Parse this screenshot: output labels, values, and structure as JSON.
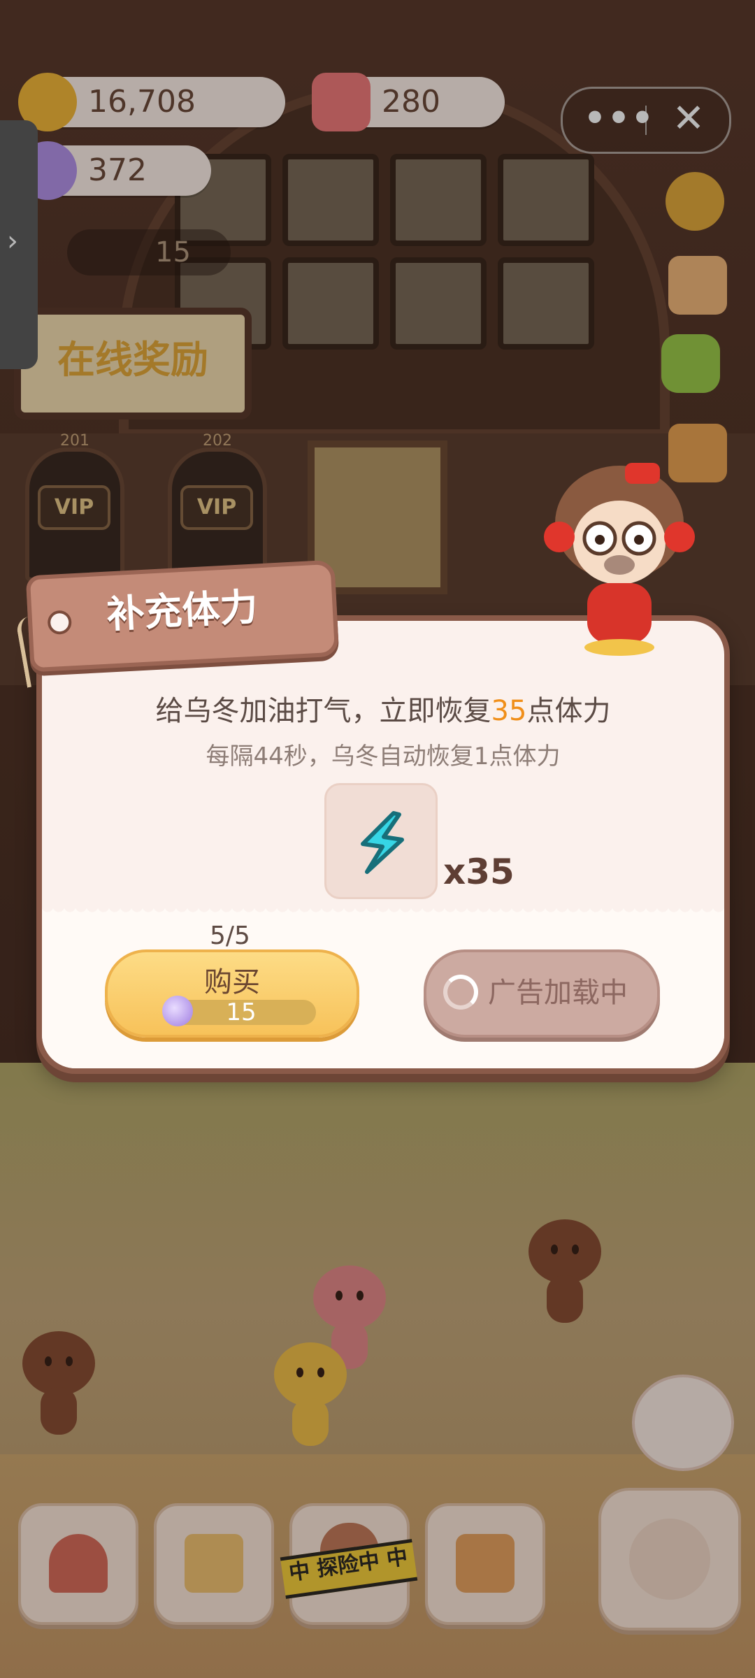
{
  "hud": {
    "coins": "16,708",
    "candles": "280",
    "candy": "372",
    "small_counter": "15",
    "capsule_more": "•••",
    "capsule_close": "✕",
    "side_tab_arrow": "›"
  },
  "scene": {
    "sign_text": "在线奖励",
    "door_left_num": "201",
    "door_right_num": "202",
    "vip_label": "VIP"
  },
  "dialog": {
    "title": "补充体力",
    "message_prefix": "给乌冬加油打气，立即恢复",
    "message_amount": "35",
    "message_suffix": "点体力",
    "sub_message": "每隔44秒，乌冬自动恢复1点体力",
    "item_quantity": "x35",
    "purchase_limit": "5/5",
    "buy_label": "购买",
    "buy_price": "15",
    "ad_label": "广告加载中"
  },
  "nav": {
    "explore_label": "中 探险中 中"
  },
  "colors": {
    "accent_orange": "#f08f1a",
    "buy_button": "#f7c25a",
    "ad_button": "#ccaaa1",
    "dialog_bg": "#fbf1ed",
    "title_tag": "#c48b78"
  },
  "icons": [
    "coin-icon",
    "candle-icon",
    "candy-icon",
    "gear-icon",
    "stamp-icon",
    "star-icon",
    "backpack-icon",
    "energy-icon",
    "spinner-icon",
    "house-icon",
    "notebook-icon",
    "shop-icon",
    "fish-bag-icon",
    "chat-bubble-icon"
  ]
}
